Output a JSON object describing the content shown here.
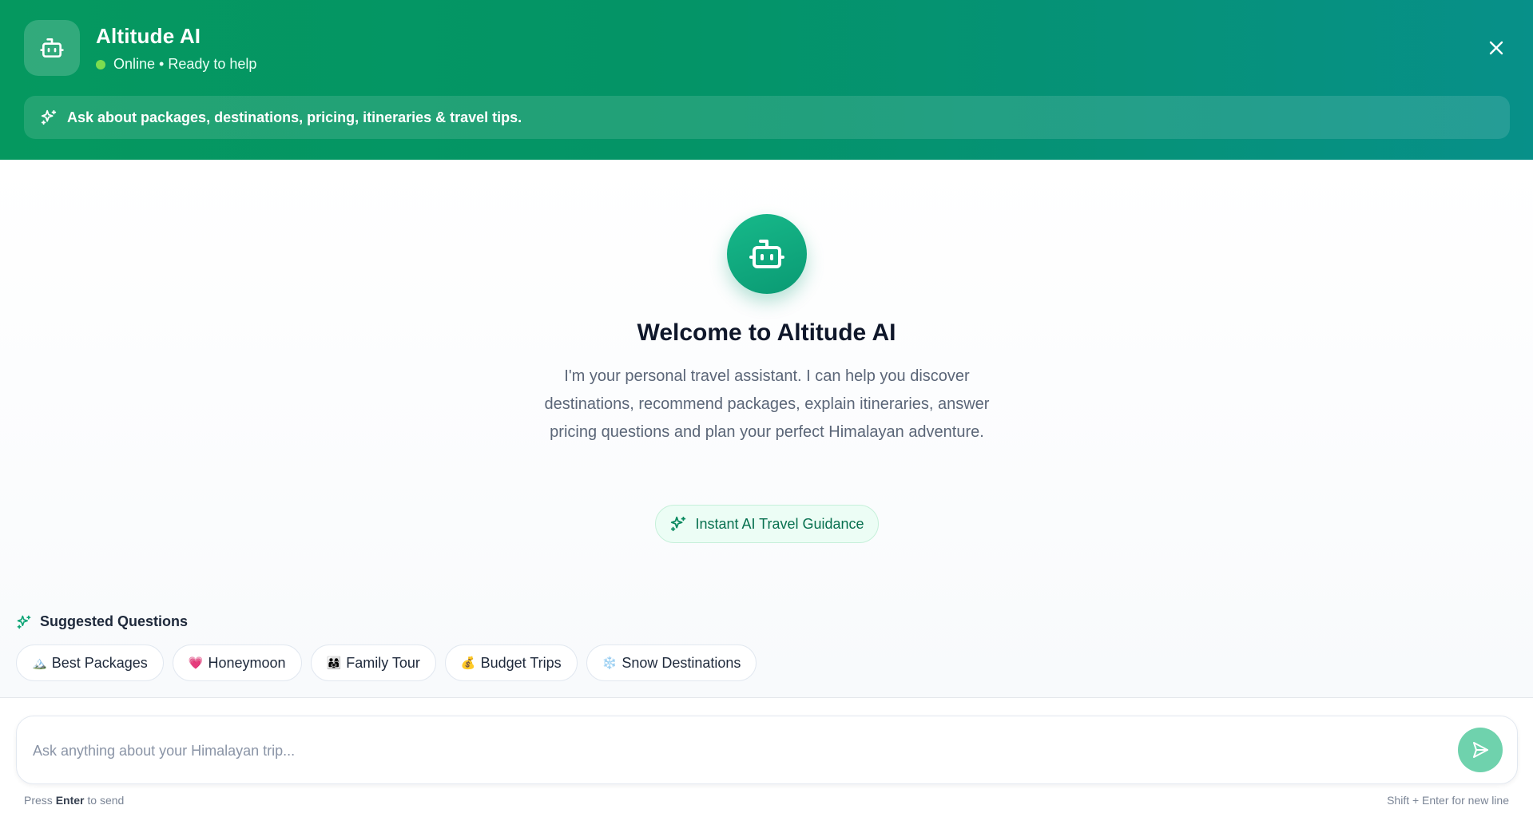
{
  "header": {
    "title": "Altitude AI",
    "status": "Online • Ready to help",
    "hint": "Ask about packages, destinations, pricing, itineraries & travel tips.",
    "colors": {
      "gradient_start": "#05985f",
      "gradient_end": "#079089",
      "status_dot": "#7ddc4f"
    }
  },
  "welcome": {
    "title": "Welcome to Altitude AI",
    "description": "I'm your personal travel assistant. I can help you discover destinations, recommend packages, explain itineraries, answer pricing questions and plan your perfect Himalayan adventure.",
    "badge": "Instant AI Travel Guidance"
  },
  "suggestions": {
    "heading": "Suggested Questions",
    "items": [
      {
        "emoji": "🏔️",
        "label": "Best Packages"
      },
      {
        "emoji": "💗",
        "label": "Honeymoon"
      },
      {
        "emoji": "👨‍👩‍👧",
        "label": "Family Tour"
      },
      {
        "emoji": "💰",
        "label": "Budget Trips"
      },
      {
        "emoji": "❄️",
        "label": "Snow Destinations"
      }
    ]
  },
  "composer": {
    "placeholder": "Ask anything about your Himalayan trip...",
    "value": "",
    "hint_prefix": "Press",
    "hint_key": "Enter",
    "hint_suffix": "to send",
    "hint_right": "Shift + Enter for new line"
  },
  "icons": {
    "bot": "bot-icon",
    "close": "close-icon",
    "sparkles": "sparkles-icon",
    "send": "send-icon"
  },
  "accent": "#10a677"
}
